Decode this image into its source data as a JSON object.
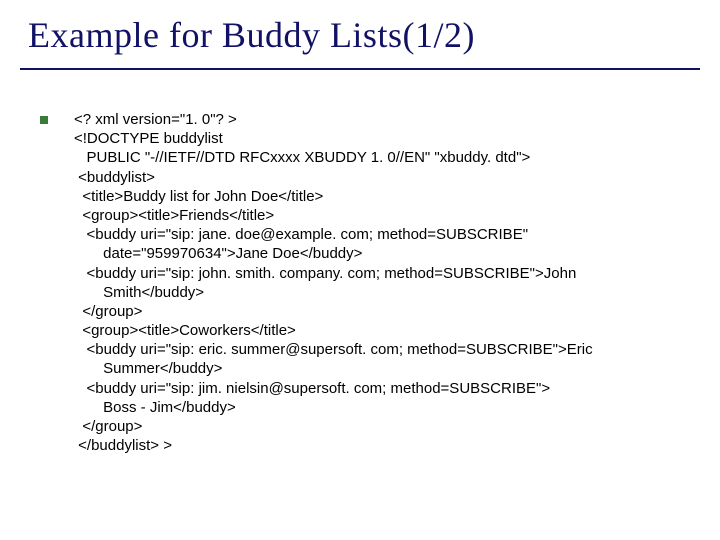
{
  "slide": {
    "title": "Example for Buddy Lists(1/2)"
  },
  "code": {
    "lines": [
      "<? xml version=\"1. 0\"? >",
      "<!DOCTYPE buddylist",
      "   PUBLIC \"-//IETF//DTD RFCxxxx XBUDDY 1. 0//EN\" \"xbuddy. dtd\">",
      " <buddylist>",
      "  <title>Buddy list for John Doe</title>",
      "  <group><title>Friends</title>",
      "   <buddy uri=\"sip: jane. doe@example. com; method=SUBSCRIBE\"",
      "       date=\"959970634\">Jane Doe</buddy>",
      "   <buddy uri=\"sip: john. smith. company. com; method=SUBSCRIBE\">John",
      "       Smith</buddy>",
      "  </group>",
      "  <group><title>Coworkers</title>",
      "   <buddy uri=\"sip: eric. summer@supersoft. com; method=SUBSCRIBE\">Eric",
      "       Summer</buddy>",
      "   <buddy uri=\"sip: jim. nielsin@supersoft. com; method=SUBSCRIBE\">",
      "       Boss - Jim</buddy>",
      "  </group>",
      " </buddylist> >"
    ]
  }
}
